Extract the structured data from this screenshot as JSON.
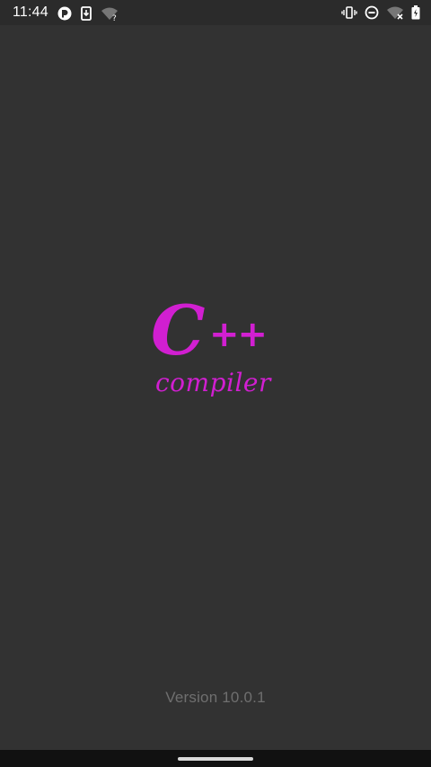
{
  "status_bar": {
    "time": "11:44",
    "left_icons": [
      "app-notification-icon",
      "download-notification-icon",
      "wifi-unknown-icon"
    ],
    "right_icons": [
      "vibrate-icon",
      "do-not-disturb-icon",
      "wifi-no-internet-icon",
      "battery-charging-icon"
    ]
  },
  "splash": {
    "logo_main": "C",
    "logo_plus": "++",
    "logo_word": "compiler",
    "version": "Version 10.0.1",
    "accent_color": "#d11fd1",
    "background_color": "#323232"
  }
}
